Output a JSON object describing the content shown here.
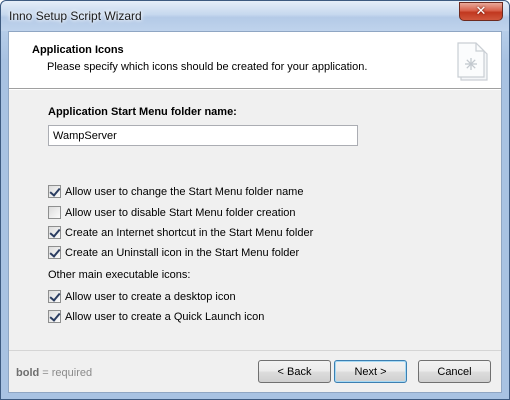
{
  "window": {
    "title": "Inno Setup Script Wizard",
    "close_glyph": "✕"
  },
  "header": {
    "title": "Application Icons",
    "subtitle": "Please specify which icons should be created for your application.",
    "icon": "wizard-page-icon"
  },
  "form": {
    "folder_label": "Application Start Menu folder name:",
    "folder_value": "WampServer",
    "options": [
      {
        "label": "Allow user to change the Start Menu folder name",
        "checked": true
      },
      {
        "label": "Allow user to disable Start Menu folder creation",
        "checked": false
      },
      {
        "label": "Create an Internet shortcut in the Start Menu folder",
        "checked": true
      },
      {
        "label": "Create an Uninstall icon in the Start Menu folder",
        "checked": true
      }
    ],
    "other_label": "Other main executable icons:",
    "other_options": [
      {
        "label": "Allow user to create a desktop icon",
        "checked": true
      },
      {
        "label": "Allow user to create a Quick Launch icon",
        "checked": true
      }
    ]
  },
  "footer": {
    "legend_bold": "bold",
    "legend_rest": " = required",
    "back_label": "< Back",
    "next_label": "Next >",
    "cancel_label": "Cancel"
  }
}
